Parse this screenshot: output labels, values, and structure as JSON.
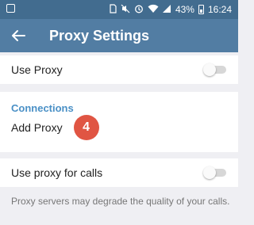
{
  "status_bar": {
    "battery": "43%",
    "time": "16:24",
    "icons": [
      "sim-icon",
      "mute-icon",
      "alarm-icon",
      "wifi-icon",
      "signal-icon",
      "battery-icon"
    ]
  },
  "app_bar": {
    "title": "Proxy Settings",
    "back_icon": "arrow-back-icon"
  },
  "use_proxy": {
    "label": "Use Proxy",
    "enabled": false
  },
  "connections": {
    "header": "Connections",
    "add_proxy_label": "Add Proxy",
    "step_badge": "4"
  },
  "use_proxy_calls": {
    "label": "Use proxy for calls",
    "enabled": false
  },
  "footer_note": "Proxy servers may degrade the quality of your calls.",
  "colors": {
    "status_bar": "#426c8f",
    "app_bar": "#527da3",
    "section_header": "#4a90c6",
    "badge": "#e05543",
    "background": "#efeff3"
  }
}
